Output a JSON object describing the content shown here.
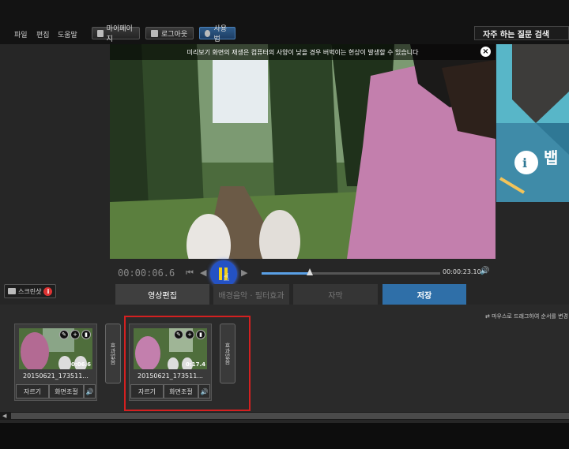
{
  "menu": [
    "파일",
    "편집",
    "도움말"
  ],
  "header": {
    "mypage": "마이페이지",
    "logout": "로그아웃",
    "usage": "사용법",
    "faq": "자주 하는 질문 검색"
  },
  "preview": {
    "notice": "미리보기 화면의 재생은 컴퓨터의 사양이 낮을 경우 버벅이는 현상이 발생할 수 있습니다",
    "close": "×"
  },
  "ad": {
    "text": "뱁"
  },
  "player": {
    "current_time": "00:00:06.6",
    "total_time": "00:00:23.10",
    "progress": 0.27
  },
  "screenshot": {
    "label": "스크린샷",
    "info": "i"
  },
  "tabs": [
    "영상편집",
    "배경음악 · 필터효과",
    "자막",
    "저장"
  ],
  "hint": "마우스로 드래그하여 순서를 변경",
  "clips": [
    {
      "name": "20150621_173511...",
      "duration": "0:06.6",
      "trim": "자르기",
      "adjust": "화면조절"
    },
    {
      "name": "20150621_173511...",
      "duration": "0:17.4",
      "trim": "자르기",
      "adjust": "화면조절"
    }
  ],
  "effect_label": "효과없음",
  "colors": {
    "accent": "#2f6fa8",
    "highlight": "#d42020",
    "pause": "#f2d019"
  }
}
